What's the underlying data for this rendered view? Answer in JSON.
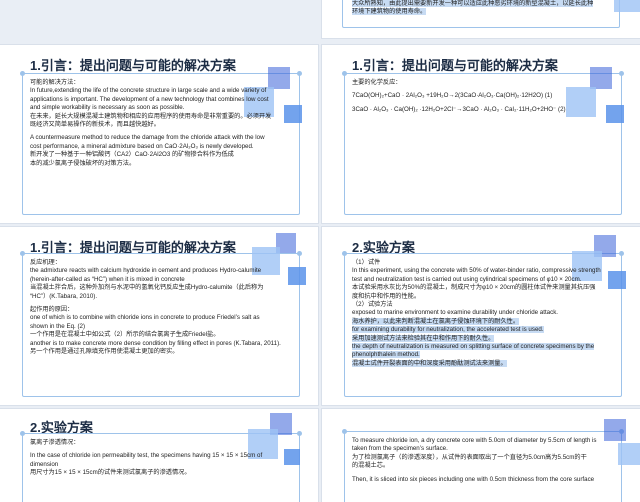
{
  "slides": [
    {
      "id": "s0",
      "title": "",
      "lines": [
        {
          "t": "大众所熟知，由此提出需要新开发一种可以适应此种恶劣环境的新型混凝土，以延长此种",
          "hl": true
        },
        {
          "t": "环境下建筑物的使用寿命。",
          "hl": true
        }
      ]
    },
    {
      "id": "s1",
      "title": "1.引言：提出问题与可能的解决方案",
      "lines": [
        {
          "t": "可能的解决方法："
        },
        {
          "t": "In future,extending the life of the concrete structure in large scale and a wide variety of"
        },
        {
          "t": "applications is important. The development of a new technology that combines low cost"
        },
        {
          "t": "and simple workability is necessary as soon as possible."
        },
        {
          "t": "在未来，延长大规模混凝土建筑物和相应的应用程序的使用寿命是非常重要的。必须开发"
        },
        {
          "t": "既经济又简单易操作的新技术，而且越快越好。"
        },
        {
          "t": ""
        },
        {
          "t": "A countermeasure method to reduce the damage from the chloride attack with the low"
        },
        {
          "t": "cost performance, a mineral admixture based on CaO·2Al₂O₃ is newly developed."
        },
        {
          "t": "新开发了一种基于一种铝酸钙（CA2）CaO·2Al2O3 的矿物掺合料作为低成"
        },
        {
          "t": "本的减少氯离子侵蚀破坏的对策方法。"
        }
      ]
    },
    {
      "id": "s2",
      "title": "1.引言：提出问题与可能的解决方案",
      "lines": [
        {
          "t": "主要的化学反应："
        },
        {
          "t": ""
        },
        {
          "t": "7CaO(OH)₂+CaO · 2Al₂O₃ +19H₂O→2(3CaO·Al₂O₃·Ca(OH)₂·12H2O)        (1)"
        },
        {
          "t": ""
        },
        {
          "t": "3CaO · Al₂O₃ · Ca(OH)₂ ·12H₂O+2Cl⁻→3CaO · Al₂O₃ · CaI₂·11H₂O+2HO⁻  (2)"
        }
      ]
    },
    {
      "id": "s3",
      "title": "1.引言：提出问题与可能的解决方案",
      "lines": [
        {
          "t": "反应机理："
        },
        {
          "t": "the admixture reacts with calcium hydroxide in cement and produces Hydro-calumite"
        },
        {
          "t": "(herein-after-called as “HC”) when it is mixed in concrete"
        },
        {
          "t": "当混凝土拌合后，这种外加剂与水泥中的氢氧化钙反应生成Hydro-calumite（此后称为"
        },
        {
          "t": "“HC”）(K.Tabara, 2010)."
        },
        {
          "t": ""
        },
        {
          "t": "起作用的原因："
        },
        {
          "t": "one of which is to combine with chloride ions in concrete to produce Friedel’s salt as"
        },
        {
          "t": "shown in the Eq. (2)"
        },
        {
          "t": "一个作用是在混凝土中如公式（2）所示的结合氯离子生成Friedel盐。"
        },
        {
          "t": "another is to make concrete more dense condition by filling effect in pores (K.Tabara, 2011)."
        },
        {
          "t": "另一个作用是通过孔隙填充作用使混凝土更加的密实。"
        }
      ]
    },
    {
      "id": "s4",
      "title": "2.实验方案",
      "lines": [
        {
          "t": "（1）试件"
        },
        {
          "t": "In this experiment, using the concrete with 50% of water-binder ratio, compressive strength"
        },
        {
          "t": "test and neutralization test is carried out using cylindrical specimens of φ10 × 20cm."
        },
        {
          "t": "本试验采用水灰比为50%的混凝土，制成尺寸为φ10 × 20cm的圆柱体试件来测量其抗压强"
        },
        {
          "t": "度和抗中和作用的性能。"
        },
        {
          "t": "（2）试验方法"
        },
        {
          "t": "exposed to marine environment to examine durability under chloride attack."
        },
        {
          "t": "海水养护，以此来判断混凝土在氯离子侵蚀环境下的耐久性。",
          "hl": true
        },
        {
          "t": "for examining durability for neutralization, the accelerated test is used.",
          "hl": true
        },
        {
          "t": "采用加速测试方法来检验其在中和作用下的耐久性。",
          "hl": true
        },
        {
          "t": "the depth of neutralization is measured on splitting surface of concrete specimens by the",
          "hl": true
        },
        {
          "t": "phenolphthalein method.",
          "hl": true
        },
        {
          "t": "混凝土试件开裂表面的中和深度采用酚酞测试法来测量。",
          "hl": true
        }
      ]
    },
    {
      "id": "s5",
      "title": "2.实验方案",
      "lines": [
        {
          "t": "氯离子渗透情况："
        },
        {
          "t": ""
        },
        {
          "t": "In the case of chloride ion permeability test, the specimens having 15 × 15 × 15cm of"
        },
        {
          "t": "dimension"
        },
        {
          "t": "用尺寸为15 × 15 × 15cm的试件来测试氯离子的渗透情况。"
        }
      ]
    },
    {
      "id": "s6",
      "title": "",
      "lines": [
        {
          "t": "To measure chloride ion, a dry concrete core with 5.0cm of diameter by 5.5cm of length is"
        },
        {
          "t": "taken from the specimen’s surface."
        },
        {
          "t": "为了检测氯离子（的渗透深度），从试件的表面取出了一个直径为5.0cm高为5.5cm的干"
        },
        {
          "t": "的混凝土芯。"
        },
        {
          "t": ""
        },
        {
          "t": "Then, it is sliced into six pieces including one with 0.5cm thickness from the core surface"
        }
      ]
    }
  ]
}
